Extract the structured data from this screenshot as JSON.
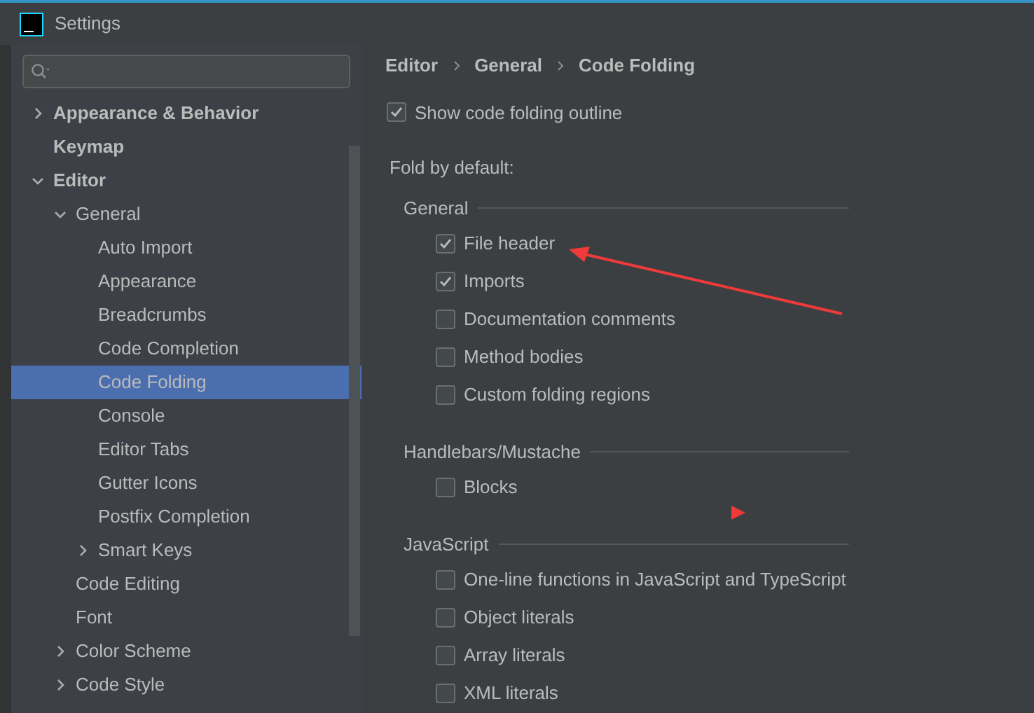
{
  "window": {
    "title": "Settings"
  },
  "sidebar": {
    "tree": [
      {
        "label": "Appearance & Behavior",
        "expanded": false
      },
      {
        "label": "Keymap"
      },
      {
        "label": "Editor",
        "expanded": true,
        "children": [
          {
            "label": "General",
            "expanded": true,
            "children": [
              {
                "label": "Auto Import",
                "selected": false
              },
              {
                "label": "Appearance",
                "selected": false
              },
              {
                "label": "Breadcrumbs",
                "selected": false
              },
              {
                "label": "Code Completion",
                "selected": false
              },
              {
                "label": "Code Folding",
                "selected": true
              },
              {
                "label": "Console",
                "selected": false
              },
              {
                "label": "Editor Tabs",
                "selected": false
              },
              {
                "label": "Gutter Icons",
                "selected": false
              },
              {
                "label": "Postfix Completion",
                "selected": false
              },
              {
                "label": "Smart Keys",
                "expanded": false,
                "selected": false
              }
            ]
          },
          {
            "label": "Code Editing"
          },
          {
            "label": "Font"
          },
          {
            "label": "Color Scheme",
            "expanded": false
          },
          {
            "label": "Code Style",
            "expanded": false
          }
        ]
      }
    ]
  },
  "breadcrumbs": [
    "Editor",
    "General",
    "Code Folding"
  ],
  "show_outline": {
    "label": "Show code folding outline",
    "checked": true
  },
  "fold_label": "Fold by default:",
  "groups": [
    {
      "title": "General",
      "options": [
        {
          "label": "File header",
          "checked": true
        },
        {
          "label": "Imports",
          "checked": true
        },
        {
          "label": "Documentation comments",
          "checked": false
        },
        {
          "label": "Method bodies",
          "checked": false
        },
        {
          "label": "Custom folding regions",
          "checked": false
        }
      ]
    },
    {
      "title": "Handlebars/Mustache",
      "options": [
        {
          "label": "Blocks",
          "checked": false
        }
      ]
    },
    {
      "title": "JavaScript",
      "options": [
        {
          "label": "One-line functions in JavaScript and TypeScript",
          "checked": false
        },
        {
          "label": "Object literals",
          "checked": false
        },
        {
          "label": "Array literals",
          "checked": false
        },
        {
          "label": "XML literals",
          "checked": false
        }
      ]
    }
  ]
}
